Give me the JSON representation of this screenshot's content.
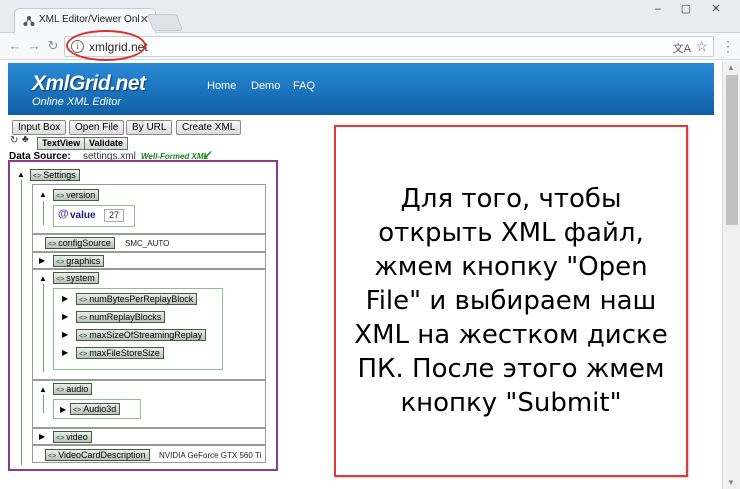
{
  "browser": {
    "tab_title": "XML Editor/Viewer Online",
    "url": "xmlgrid.net",
    "translate_icon": "translate-icon",
    "bookmark_icon": "star-icon"
  },
  "site": {
    "logo": "XmlGrid.net",
    "logo_subtitle": "Online XML Editor",
    "nav": [
      "Home",
      "Demo",
      "FAQ"
    ]
  },
  "toolbar": {
    "buttons": [
      "Input Box",
      "Open File",
      "By URL",
      "Create XML"
    ],
    "textview": "TextView",
    "validate": "Validate"
  },
  "data_source": {
    "label": "Data Source:",
    "value": "settings.xml",
    "status": "Well-Formed XML"
  },
  "tree": {
    "settings": "Settings",
    "version": "version",
    "attr_name": "value",
    "attr_value": "27",
    "configSource": "configSource",
    "configSource_value": "SMC_AUTO",
    "graphics": "graphics",
    "system": "system",
    "system_children": [
      "numBytesPerReplayBlock",
      "numReplayBlocks",
      "maxSizeOfStreamingReplay",
      "maxFileStoreSize"
    ],
    "audio": "audio",
    "audio3d": "Audio3d",
    "video": "video",
    "videoCard": "VideoCardDescription",
    "videoCard_value": "NVIDIA GeForce GTX 560 Ti"
  },
  "callout": {
    "text": "Для того, чтобы открыть XML файл, жмем кнопку \"Open File\" и выбираем наш XML на жестком диске ПК. После этого жмем кнопку \"Submit\""
  },
  "colors": {
    "banner": "#1a73c4",
    "callout_border": "#e23a34",
    "highlight_circle": "#d9342b",
    "tree_border": "#8a3c8a"
  }
}
